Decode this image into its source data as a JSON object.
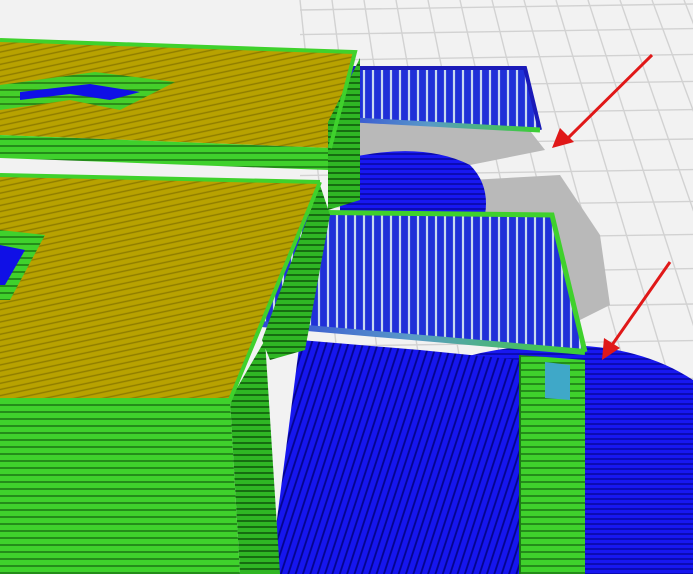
{
  "viewport": {
    "view": "3d-layer-preview",
    "background_color": "#f2f2f2",
    "grid_color": "#d2d2d2",
    "shadow_color": "#b9b9b9"
  },
  "legend_colors": {
    "top_surface": "#b9a400",
    "outer_wall": "#3fd12c",
    "support": "#1010e6",
    "inner_wall": "#2a9c4c",
    "travel_bridge": "#5aa0c0"
  },
  "annotations": [
    {
      "name": "arrow-upper",
      "color": "#e01818"
    },
    {
      "name": "arrow-lower",
      "color": "#e01818"
    }
  ]
}
